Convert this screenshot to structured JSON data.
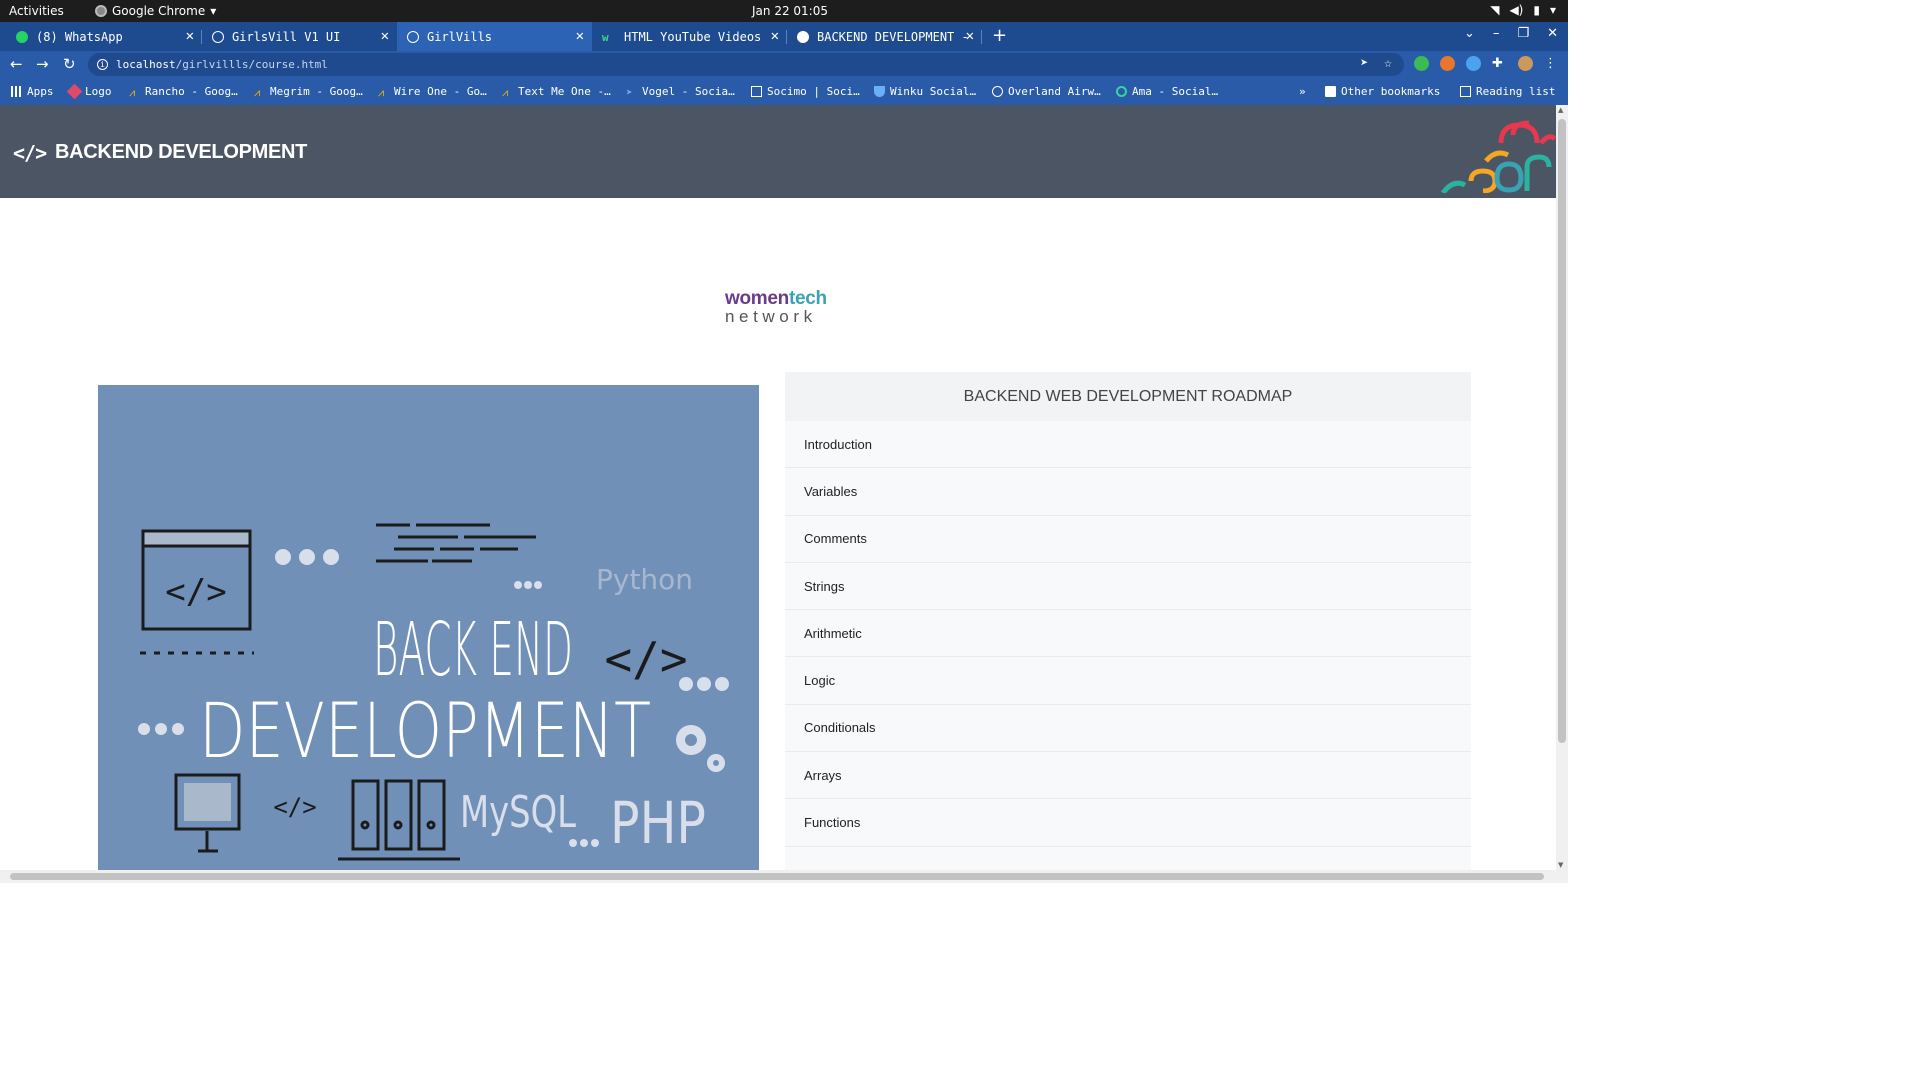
{
  "system": {
    "activities": "Activities",
    "app_name": "Google Chrome",
    "clock": "Jan 22  01:05"
  },
  "tabs": [
    {
      "label": "(8) WhatsApp",
      "icon": "whatsapp-icon"
    },
    {
      "label": "GirlsVill V1 UI",
      "icon": "globe-icon"
    },
    {
      "label": "GirlVills",
      "icon": "globe-icon",
      "active": true
    },
    {
      "label": "HTML YouTube Videos",
      "icon": "w-icon"
    },
    {
      "label": "BACKEND DEVELOPMENT -",
      "icon": "google-icon"
    }
  ],
  "omnibox": {
    "host": "localhost",
    "path": "/girlvillls/course.html"
  },
  "bookmarks": [
    {
      "label": "Apps"
    },
    {
      "label": "Logo"
    },
    {
      "label": "Rancho - Goog…"
    },
    {
      "label": "Megrim - Goog…"
    },
    {
      "label": "Wire One - Go…"
    },
    {
      "label": "Text Me One -…"
    },
    {
      "label": "Vogel - Socia…"
    },
    {
      "label": "Socimo | Soci…"
    },
    {
      "label": "Winku Social…"
    },
    {
      "label": "Overland Airw…"
    },
    {
      "label": "Ama - Social…"
    }
  ],
  "bookmarks_more": "»",
  "other_bookmarks": "Other bookmarks",
  "reading_list": "Reading list",
  "header": {
    "icon_text": "</>",
    "title": "BACKEND DEVELOPMENT"
  },
  "logo": {
    "part1": "women",
    "part2": "tech",
    "part3": "network"
  },
  "banner": {
    "line1": "BACK END",
    "line2": "DEVELOPMENT",
    "python": "Python",
    "mysql": "MySQL",
    "php": "PHP"
  },
  "roadmap": {
    "title": "BACKEND WEB DEVELOPMENT ROADMAP",
    "items": [
      "Introduction",
      "Variables",
      "Comments",
      "Strings",
      "Arithmetic",
      "Logic",
      "Conditionals",
      "Arrays",
      "Functions",
      ""
    ]
  },
  "colors": {
    "header_bg": "#4c5564",
    "banner_bg": "#7090b8",
    "chrome_blue": "#2a5ba8"
  }
}
